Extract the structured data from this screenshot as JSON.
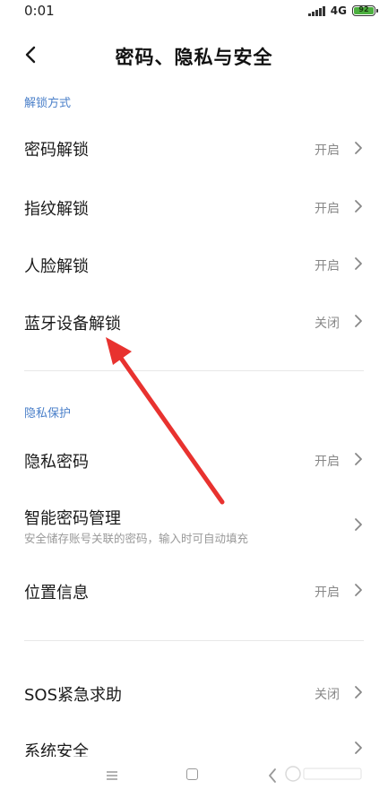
{
  "status_bar": {
    "time": "0:01",
    "network": "4G",
    "battery": "92"
  },
  "header": {
    "title": "密码、隐私与安全"
  },
  "sections": {
    "unlock": {
      "title": "解锁方式",
      "items": [
        {
          "title": "密码解锁",
          "value": "开启"
        },
        {
          "title": "指纹解锁",
          "value": "开启"
        },
        {
          "title": "人脸解锁",
          "value": "开启"
        },
        {
          "title": "蓝牙设备解锁",
          "value": "关闭"
        }
      ]
    },
    "privacy": {
      "title": "隐私保护",
      "items": [
        {
          "title": "隐私密码",
          "value": "开启"
        },
        {
          "title": "智能密码管理",
          "subtitle": "安全储存账号关联的密码，输入时可自动填充"
        },
        {
          "title": "位置信息",
          "value": "开启"
        }
      ]
    },
    "other": {
      "items": [
        {
          "title": "SOS紧急求助",
          "value": "关闭"
        },
        {
          "title": "系统安全"
        }
      ]
    }
  },
  "annotation": {
    "color": "#e8322f"
  },
  "icons": {
    "back": "back-arrow-icon",
    "chevron": "chevron-right-icon"
  }
}
